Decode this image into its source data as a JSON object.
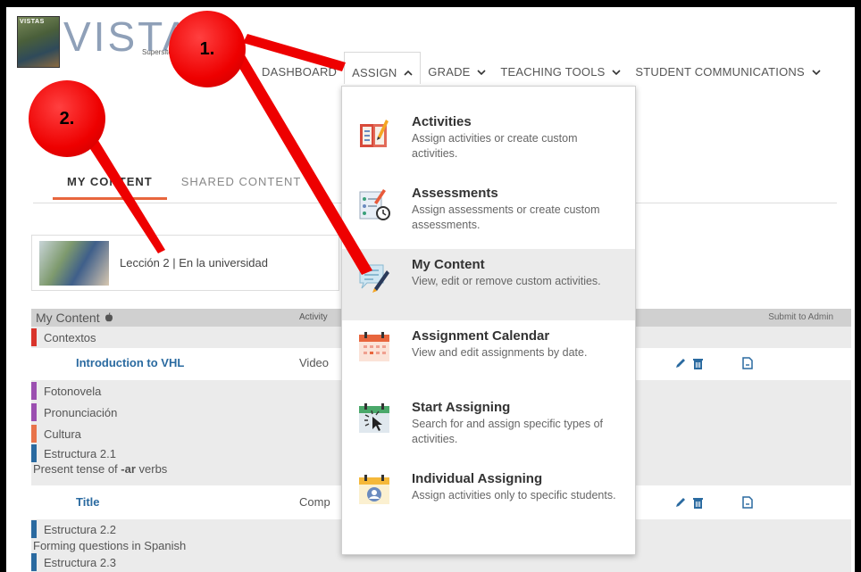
{
  "logo": {
    "cover_text": "VISTAS",
    "title": "VISTAS",
    "subtitle": "Supersite"
  },
  "nav": {
    "items": [
      {
        "label": "DASHBOARD",
        "chevron": ""
      },
      {
        "label": "ASSIGN",
        "chevron": "^"
      },
      {
        "label": "GRADE",
        "chevron": "v"
      },
      {
        "label": "TEACHING TOOLS",
        "chevron": "v"
      },
      {
        "label": "STUDENT COMMUNICATIONS",
        "chevron": "v"
      }
    ]
  },
  "tabs": [
    {
      "label": "MY CONTENT",
      "active": true
    },
    {
      "label": "SHARED CONTENT",
      "active": false
    }
  ],
  "lesson": {
    "label": "Lección 2 | En la universidad"
  },
  "table": {
    "header": {
      "col1": "My Content",
      "col2": "Activity",
      "col3": "Submit to Admin"
    },
    "sections": {
      "contextos": "Contextos",
      "fotonovela": "Fotonovela",
      "pronunciacion": "Pronunciación",
      "cultura": "Cultura",
      "estructura21": "Estructura 2.1",
      "estructura21_sub_pre": "Present tense of ",
      "estructura21_sub_bold": "-ar",
      "estructura21_sub_post": " verbs",
      "estructura22": "Estructura 2.2",
      "estructura22_sub": "Forming questions in Spanish",
      "estructura23": "Estructura 2.3"
    },
    "rows": [
      {
        "title": "Introduction to VHL",
        "activity": "Video"
      },
      {
        "title": "Title",
        "activity": "Comp"
      }
    ]
  },
  "dropdown": {
    "items": [
      {
        "title": "Activities",
        "desc": "Assign activities or create custom activities."
      },
      {
        "title": "Assessments",
        "desc": "Assign assessments or create custom assessments."
      },
      {
        "title": "My Content",
        "desc": "View, edit or remove custom activities."
      },
      {
        "title": "Assignment Calendar",
        "desc": "View and edit assignments by date."
      },
      {
        "title": "Start Assigning",
        "desc": "Search for and assign specific types of activities."
      },
      {
        "title": "Individual Assigning",
        "desc": "Assign activities only to specific students."
      }
    ]
  },
  "annotations": {
    "one": "1.",
    "two": "2."
  },
  "icons": {
    "apple": "apple-icon",
    "edit": "pencil-icon",
    "trash": "trash-icon",
    "submit": "document-icon"
  },
  "colors": {
    "accent": "#e8663d",
    "link": "#2a6aa0",
    "annotation": "#ee0000",
    "bar_red": "#d9342b",
    "bar_purple": "#9b4fb0",
    "bar_orange": "#e8734a",
    "bar_blue": "#2a6aa0"
  }
}
